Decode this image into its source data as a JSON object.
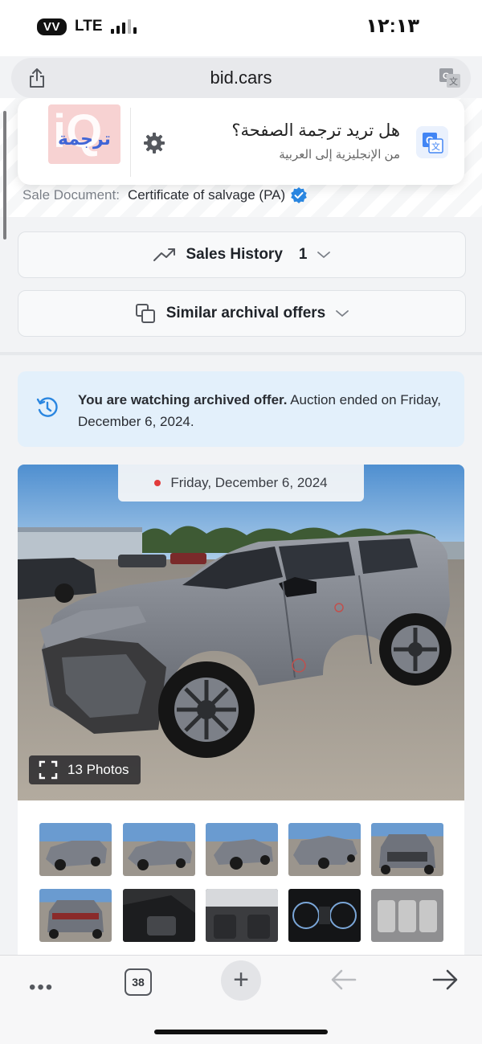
{
  "status_bar": {
    "carrier": "VV",
    "network": "LTE",
    "time": "١٢:١٣"
  },
  "address_bar": {
    "url": "bid.cars",
    "share_icon": "share-icon",
    "translate_icon": "translate-icon"
  },
  "translate_popup": {
    "logo_text": "ترجمة",
    "logo_letters": "iQ",
    "title": "هل تريد ترجمة الصفحة؟",
    "subtitle": "من الإنجليزية إلى العربية",
    "settings_icon": "gear-icon",
    "translate_app_icon": "google-translate-icon"
  },
  "sale_document": {
    "label": "Sale Document:",
    "value": "Certificate of salvage (PA)",
    "icon": "verified-badge-icon"
  },
  "sales_history": {
    "label": "Sales History",
    "count": "1",
    "icon": "trend-up-icon"
  },
  "similar_offers": {
    "label": "Similar archival offers",
    "icon": "copy-icon"
  },
  "notice": {
    "bold": "You are watching archived offer.",
    "rest": " Auction ended on Friday, December 6, 2024.",
    "icon": "history-icon"
  },
  "main_photo": {
    "date": "Friday, December 6, 2024",
    "photos_label": "13 Photos",
    "expand_icon": "fullscreen-icon"
  },
  "thumbnails_count_visible": 10,
  "toolbar": {
    "more_label": "•••",
    "tabs_count": "38",
    "new_tab_label": "+",
    "back_icon": "arrow-left-icon",
    "forward_icon": "arrow-right-icon"
  },
  "colors": {
    "notice_bg": "#e3f0fb",
    "accent_blue": "#2a86e0",
    "date_dot": "#e23b3b",
    "car_body": "#7b7f88"
  }
}
